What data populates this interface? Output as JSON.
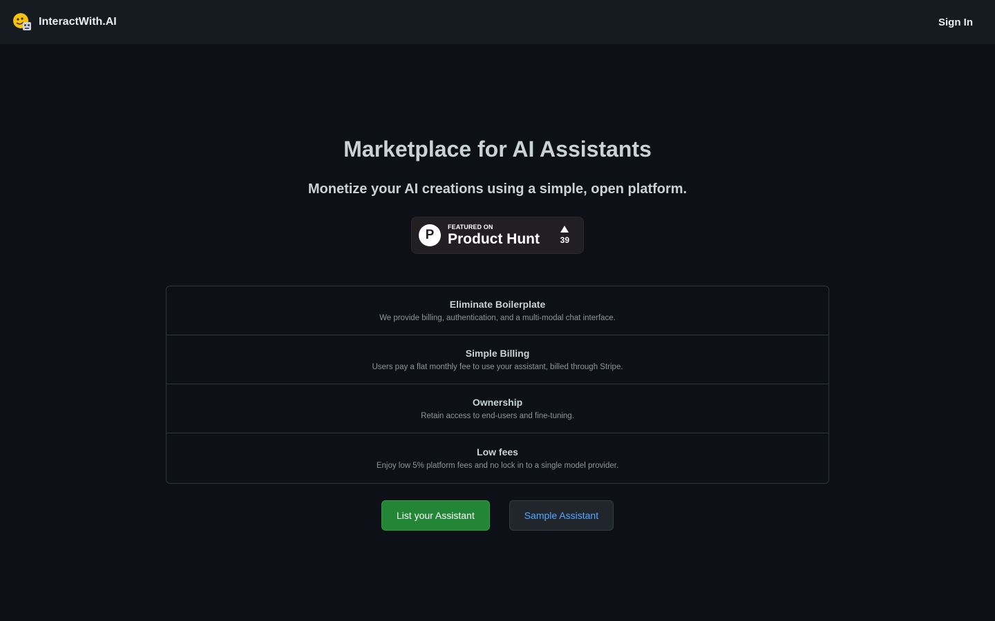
{
  "header": {
    "brand_name": "InteractWith.AI",
    "logo_icon": "smiley-robot-icon",
    "signin_label": "Sign In"
  },
  "hero": {
    "title": "Marketplace for AI Assistants",
    "subtitle": "Monetize your AI creations using a simple, open platform."
  },
  "product_hunt": {
    "logo_letter": "P",
    "featured_label": "FEATURED ON",
    "name": "Product Hunt",
    "upvote_icon": "upvote-arrow-icon",
    "votes": "39"
  },
  "features": [
    {
      "title": "Eliminate Boilerplate",
      "description": "We provide billing, authentication, and a multi-modal chat interface."
    },
    {
      "title": "Simple Billing",
      "description": "Users pay a flat monthly fee to use your assistant, billed through Stripe."
    },
    {
      "title": "Ownership",
      "description": "Retain access to end-users and fine-tuning."
    },
    {
      "title": "Low fees",
      "description": "Enjoy low 5% platform fees and no lock in to a single model provider."
    }
  ],
  "actions": {
    "primary_label": "List your Assistant",
    "secondary_label": "Sample Assistant"
  },
  "colors": {
    "background": "#0d1117",
    "header": "#161b22",
    "primary_button": "#238636",
    "link": "#58a6ff"
  }
}
